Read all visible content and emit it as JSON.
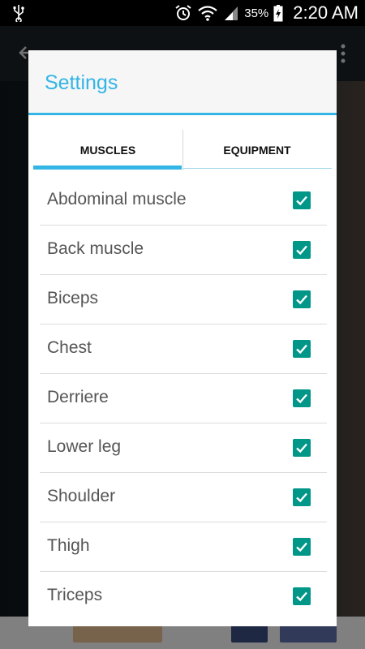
{
  "status_bar": {
    "battery_percent": "35%",
    "time": "2:20 AM",
    "icons": [
      "usb-icon",
      "alarm-icon",
      "wifi-icon",
      "signal-icon",
      "battery-charging-icon"
    ]
  },
  "dialog": {
    "title": "Settings",
    "accent_color": "#33b5e5",
    "checkbox_color": "#009688",
    "tabs": [
      {
        "label": "MUSCLES",
        "selected": true
      },
      {
        "label": "EQUIPMENT",
        "selected": false
      }
    ],
    "items": [
      {
        "label": "Abdominal muscle",
        "checked": true
      },
      {
        "label": "Back muscle",
        "checked": true
      },
      {
        "label": "Biceps",
        "checked": true
      },
      {
        "label": "Chest",
        "checked": true
      },
      {
        "label": "Derriere",
        "checked": true
      },
      {
        "label": "Lower leg",
        "checked": true
      },
      {
        "label": "Shoulder",
        "checked": true
      },
      {
        "label": "Thigh",
        "checked": true
      },
      {
        "label": "Triceps",
        "checked": true
      }
    ]
  }
}
